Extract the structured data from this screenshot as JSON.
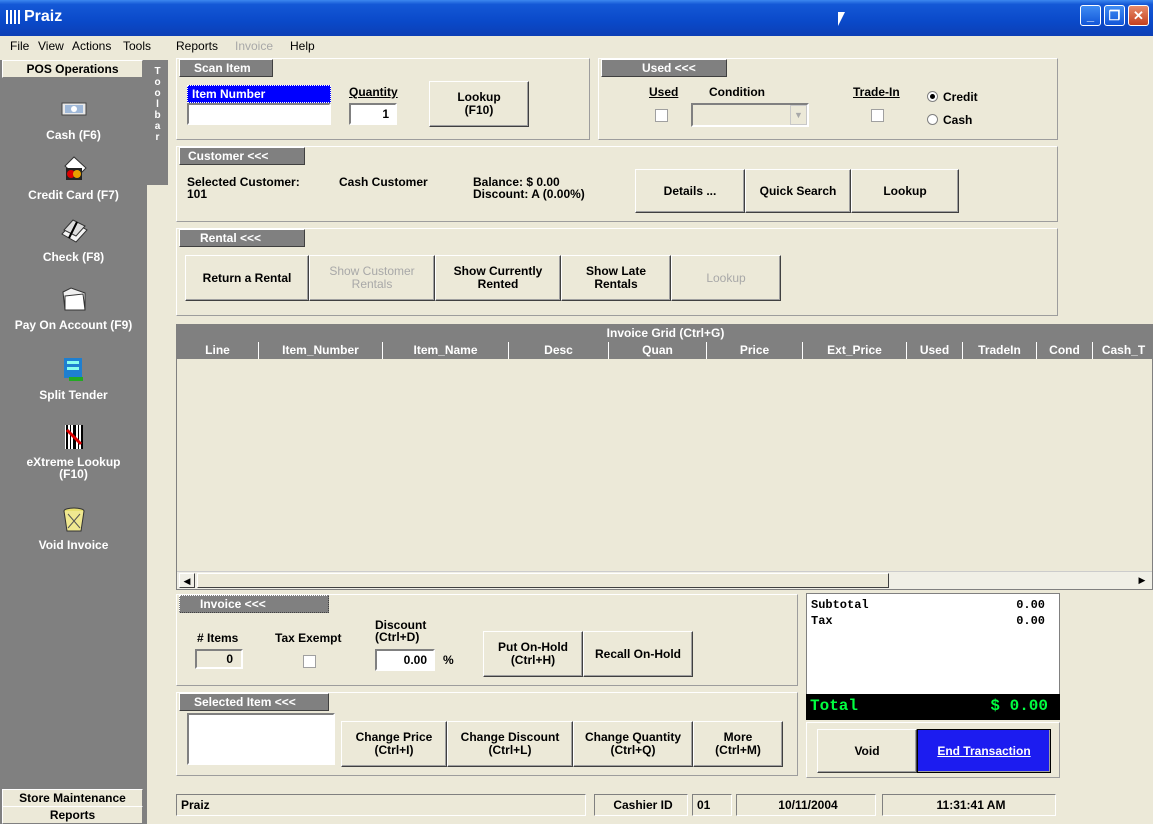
{
  "window": {
    "title": "Praiz"
  },
  "menu": [
    "File",
    "View",
    "Actions",
    "Tools",
    "Reports",
    "Invoice",
    "Help"
  ],
  "left_panel": {
    "header": "POS Operations",
    "toolbar_tab": [
      "T",
      "o",
      "o",
      "l",
      "b",
      "a",
      "r"
    ],
    "items": [
      {
        "label": "Cash (F6)",
        "icon": "cash-icon"
      },
      {
        "label": "Credit Card (F7)",
        "icon": "credit-card-icon"
      },
      {
        "label": "Check (F8)",
        "icon": "check-icon"
      },
      {
        "label": "Pay On Account (F9)",
        "icon": "folder-icon"
      },
      {
        "label": "Split Tender",
        "icon": "split-tender-icon"
      },
      {
        "label": "eXtreme Lookup (F10)",
        "icon": "barcode-icon"
      },
      {
        "label": "Void Invoice",
        "icon": "trash-icon"
      }
    ],
    "footer": [
      "Store Maintenance",
      "Reports"
    ]
  },
  "scan_item": {
    "tab": "Scan Item",
    "item_number_label": "Item Number",
    "item_number_value": "",
    "quantity_label": "Quantity",
    "quantity_value": "1",
    "lookup_button": "Lookup\n(F10)"
  },
  "used": {
    "tab": "Used <<<",
    "used_label": "Used",
    "condition_label": "Condition",
    "condition_value": "",
    "tradein_label": "Trade-In",
    "radio_credit": "Credit",
    "radio_cash": "Cash",
    "selected": "Credit"
  },
  "customer": {
    "tab": "Customer <<<",
    "selected_label": "Selected Customer:",
    "id": "101",
    "name": "Cash Customer",
    "balance": "Balance: $ 0.00",
    "discount": "Discount: A (0.00%)",
    "buttons": [
      "Details ...",
      "Quick Search",
      "Lookup"
    ]
  },
  "rental": {
    "tab": "Rental <<<",
    "buttons": [
      {
        "label": "Return a Rental",
        "enabled": true
      },
      {
        "label": "Show Customer\nRentals",
        "enabled": false
      },
      {
        "label": "Show Currently\nRented",
        "enabled": true
      },
      {
        "label": "Show Late\nRentals",
        "enabled": true
      },
      {
        "label": "Lookup",
        "enabled": false
      }
    ]
  },
  "invoice_grid": {
    "title": "Invoice Grid (Ctrl+G)",
    "columns": [
      "Line",
      "Item_Number",
      "Item_Name",
      "Desc",
      "Quan",
      "Price",
      "Ext_Price",
      "Used",
      "TradeIn",
      "Cond",
      "Cash_T"
    ]
  },
  "invoice": {
    "tab": "Invoice <<<",
    "items_label": "# Items",
    "items_value": "0",
    "tax_exempt_label": "Tax Exempt",
    "discount_label": "Discount\n(Ctrl+D)",
    "discount_value": "0.00",
    "percent": "%",
    "put_on_hold": "Put On-Hold\n(Ctrl+H)",
    "recall_on_hold": "Recall On-Hold"
  },
  "selected_item": {
    "tab": "Selected Item <<<",
    "buttons": [
      "Change Price\n(Ctrl+I)",
      "Change Discount\n(Ctrl+L)",
      "Change Quantity\n(Ctrl+Q)",
      "More\n(Ctrl+M)"
    ]
  },
  "totals": {
    "subtotal_label": "Subtotal",
    "subtotal_value": "0.00",
    "tax_label": "Tax",
    "tax_value": "0.00",
    "total_label": "Total",
    "total_value": "$ 0.00",
    "void_button": "Void",
    "end_button": "End Transaction"
  },
  "status": {
    "app": "Praiz",
    "cashier_label": "Cashier ID",
    "cashier_id": "01",
    "date": "10/11/2004",
    "time": "11:31:41 AM"
  },
  "colors": {
    "title_bar": "#0a49c9",
    "selected_field": "#0000ff",
    "total_text": "#00ff40",
    "end_button": "#1c1cf0"
  }
}
